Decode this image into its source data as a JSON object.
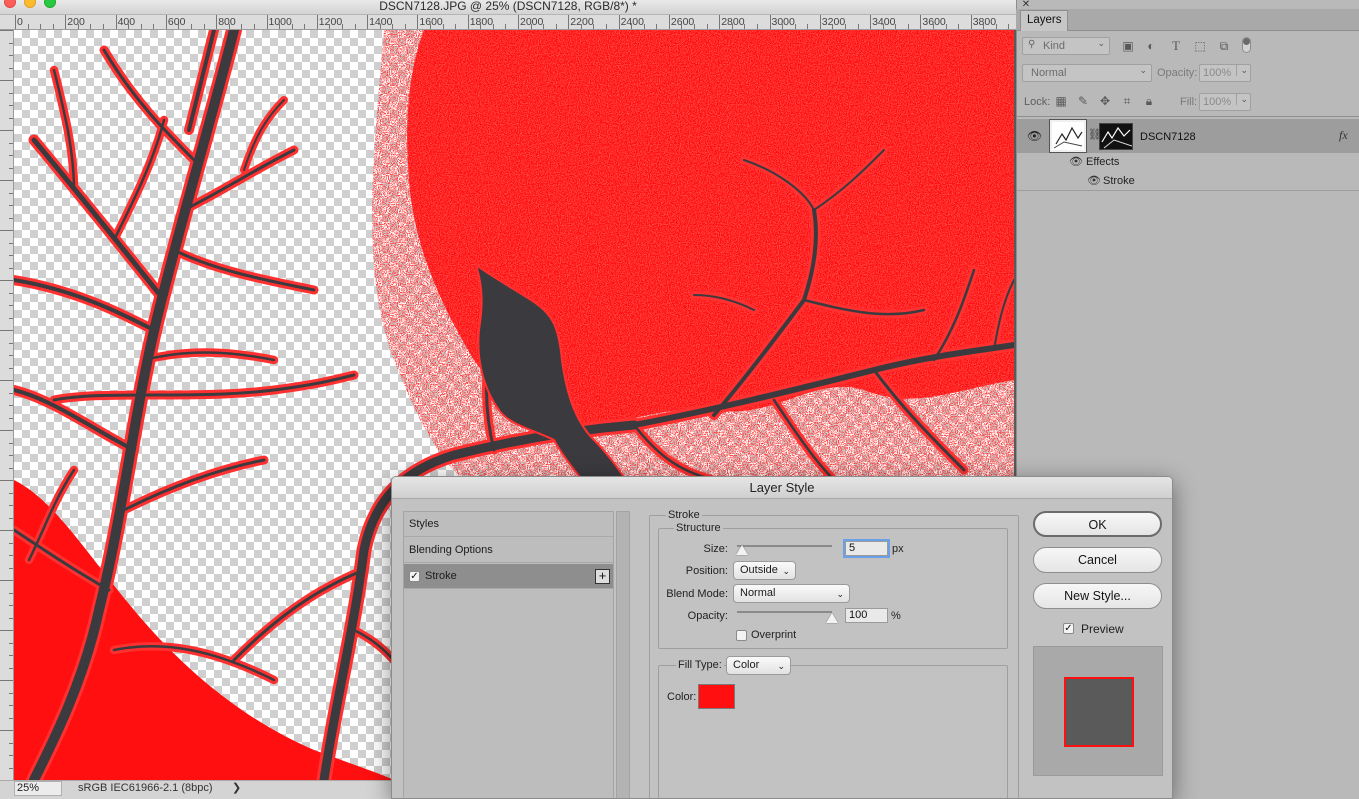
{
  "document": {
    "title": "DSCN7128.JPG @ 25% (DSCN7128, RGB/8*) *",
    "ruler_labels": [
      "0",
      "200",
      "400",
      "600",
      "800",
      "1000",
      "1200",
      "1400",
      "1600",
      "1800",
      "2000",
      "2200",
      "2400",
      "2600",
      "2800",
      "3000",
      "3200",
      "3400",
      "3600",
      "3800"
    ],
    "canvas_colors": {
      "fill": "#ff0f0f",
      "tree": "#3b3b3f",
      "stroke": "#ff3030"
    }
  },
  "status_bar": {
    "zoom": "25%",
    "profile": "sRGB IEC61966-2.1 (8bpc)",
    "arrow": "❯"
  },
  "layers_panel": {
    "close": "✕",
    "tab": "Layers",
    "filter_kind": "Kind",
    "blend_mode": "Normal",
    "opacity_label": "Opacity:",
    "opacity_value": "100%",
    "lock_label": "Lock:",
    "fill_label": "Fill:",
    "fill_value": "100%",
    "layer_name": "DSCN7128",
    "fx": "fx",
    "effects_label": "Effects",
    "stroke_label": "Stroke"
  },
  "dialog": {
    "title": "Layer Style",
    "styles_items": [
      {
        "label": "Styles"
      },
      {
        "label": "Blending Options"
      },
      {
        "label": "Stroke",
        "checked": true,
        "selected": true
      }
    ],
    "section": "Stroke",
    "structure": "Structure",
    "size_label": "Size:",
    "size_value": "5",
    "size_unit": "px",
    "position_label": "Position:",
    "position_value": "Outside",
    "blend_label": "Blend Mode:",
    "blend_value": "Normal",
    "opacity_label": "Opacity:",
    "opacity_value": "100",
    "opacity_unit": "%",
    "overprint_label": "Overprint",
    "overprint_checked": false,
    "fill_type_label": "Fill Type:",
    "fill_type_value": "Color",
    "color_label": "Color:",
    "color_value": "#ff0f0f",
    "size_slider_fraction": 0.05,
    "opacity_slider_fraction": 1.0,
    "buttons": {
      "ok": "OK",
      "cancel": "Cancel",
      "new_style": "New Style..."
    },
    "preview_label": "Preview",
    "preview_checked": true
  }
}
